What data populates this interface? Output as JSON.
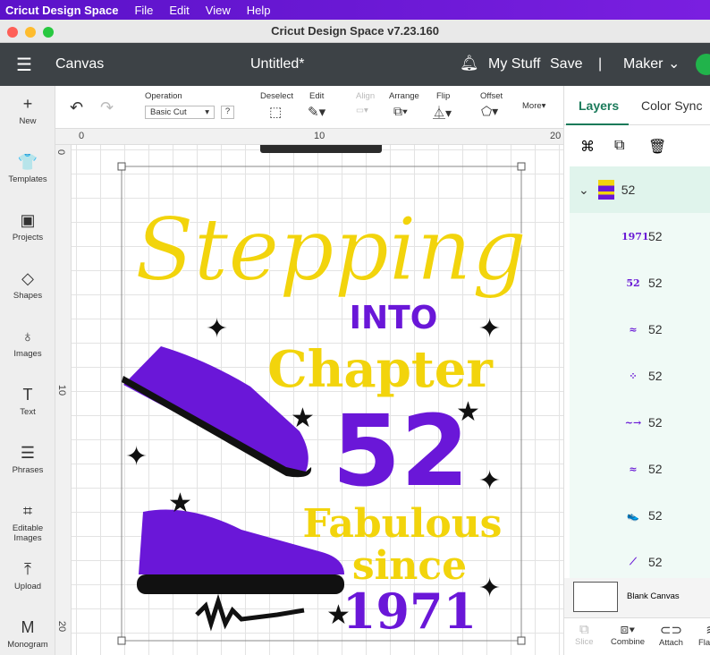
{
  "menubar": {
    "app": "Cricut Design Space",
    "items": [
      "File",
      "Edit",
      "View",
      "Help"
    ]
  },
  "window": {
    "title": "Cricut Design Space  v7.23.160"
  },
  "header": {
    "section": "Canvas",
    "doc_title": "Untitled*",
    "my_stuff": "My Stuff",
    "save": "Save",
    "separator": "|",
    "machine": "Maker"
  },
  "left_tools": [
    {
      "label": "New",
      "icon": "+"
    },
    {
      "label": "Templates",
      "icon": "👕"
    },
    {
      "label": "Projects",
      "icon": "▣"
    },
    {
      "label": "Shapes",
      "icon": "◇"
    },
    {
      "label": "Images",
      "icon": "♁"
    },
    {
      "label": "Text",
      "icon": "T"
    },
    {
      "label": "Phrases",
      "icon": "☰"
    },
    {
      "label": "Editable Images",
      "icon": "⌗"
    },
    {
      "label": "Upload",
      "icon": "⤒"
    },
    {
      "label": "Monogram",
      "icon": "M"
    }
  ],
  "toolbar": {
    "operation_label": "Operation",
    "operation_value": "Basic Cut",
    "help": "?",
    "deselect": "Deselect",
    "edit": "Edit",
    "align": "Align",
    "arrange": "Arrange",
    "flip": "Flip",
    "offset": "Offset",
    "more": "More"
  },
  "rulers": {
    "top": [
      "0",
      "10",
      "20"
    ],
    "left": [
      "0",
      "10",
      "20"
    ]
  },
  "artwork": {
    "line1": "Stepping",
    "line2": "INTO",
    "line3": "Chapter",
    "line4": "52",
    "line5": "Fabulous",
    "line6": "since",
    "line7": "1971",
    "colors": {
      "yellow": "#f2d40c",
      "purple": "#6a17d8",
      "black": "#111111"
    }
  },
  "panel": {
    "tabs": [
      "Layers",
      "Color Sync"
    ],
    "group_name": "52",
    "layers": [
      {
        "thumb": "1971",
        "name": "52"
      },
      {
        "thumb": "52",
        "name": "52"
      },
      {
        "thumb": "≈",
        "name": "52"
      },
      {
        "thumb": "⁘",
        "name": "52"
      },
      {
        "thumb": "~→",
        "name": "52"
      },
      {
        "thumb": "≈",
        "name": "52"
      },
      {
        "thumb": "👟",
        "name": "52"
      },
      {
        "thumb": "⟋",
        "name": "52"
      }
    ],
    "blank_canvas": "Blank Canvas",
    "actions": [
      "Slice",
      "Combine",
      "Attach",
      "Flatten"
    ]
  }
}
